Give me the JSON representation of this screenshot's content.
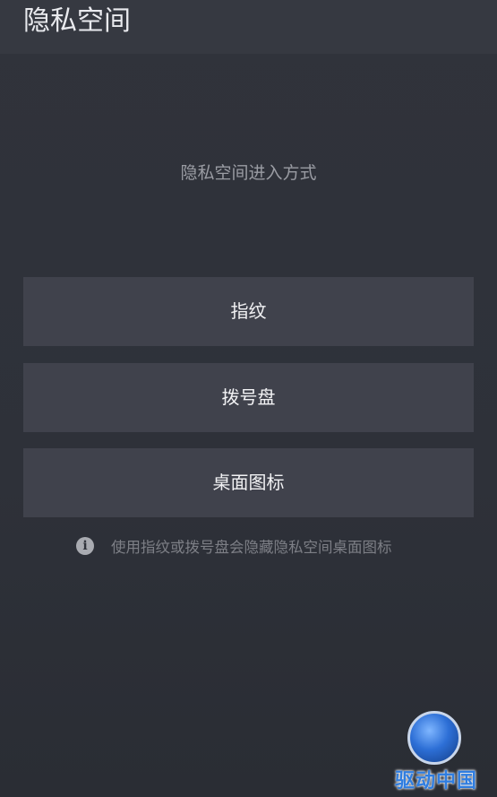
{
  "header": {
    "title": "隐私空间"
  },
  "main": {
    "subtitle": "隐私空间进入方式",
    "options": [
      {
        "label": "指纹"
      },
      {
        "label": "拨号盘"
      },
      {
        "label": "桌面图标"
      }
    ],
    "info": {
      "icon": "info-icon",
      "glyph": "i",
      "text": "使用指纹或拨号盘会隐藏隐私空间桌面图标"
    }
  },
  "watermark": {
    "text": "驱动中国"
  },
  "colors": {
    "background": "#2e3139",
    "header": "#363941",
    "button": "#40424c",
    "title_text": "#e9eaee",
    "secondary_text": "#9a9ca3",
    "hint_text": "#7d7f86"
  }
}
